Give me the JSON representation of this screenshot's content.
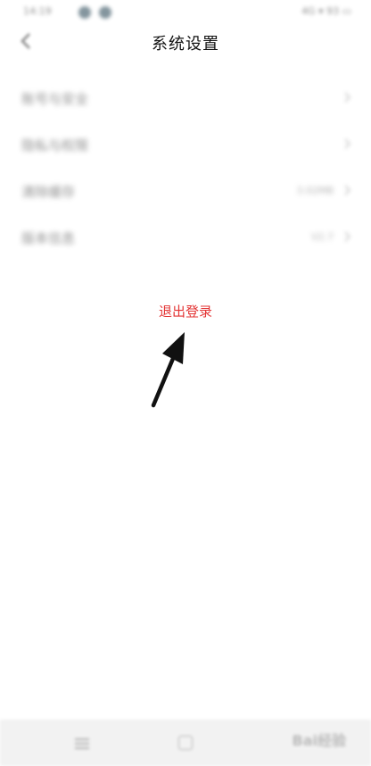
{
  "status_bar": {
    "time": "14:19",
    "right": "4G ▾ 93 ▭"
  },
  "nav": {
    "title": "系统设置"
  },
  "settings": {
    "items": [
      {
        "label": "账号与安全",
        "value": ""
      },
      {
        "label": "隐私与权限",
        "value": ""
      },
      {
        "label": "清除缓存",
        "value": "3.02MB"
      },
      {
        "label": "版本信息",
        "value": "V2.7"
      }
    ]
  },
  "logout": {
    "label": "退出登录"
  },
  "watermark": {
    "text": "Bai经验"
  },
  "colors": {
    "logout_red": "#e33434",
    "arrow": "#111111"
  }
}
